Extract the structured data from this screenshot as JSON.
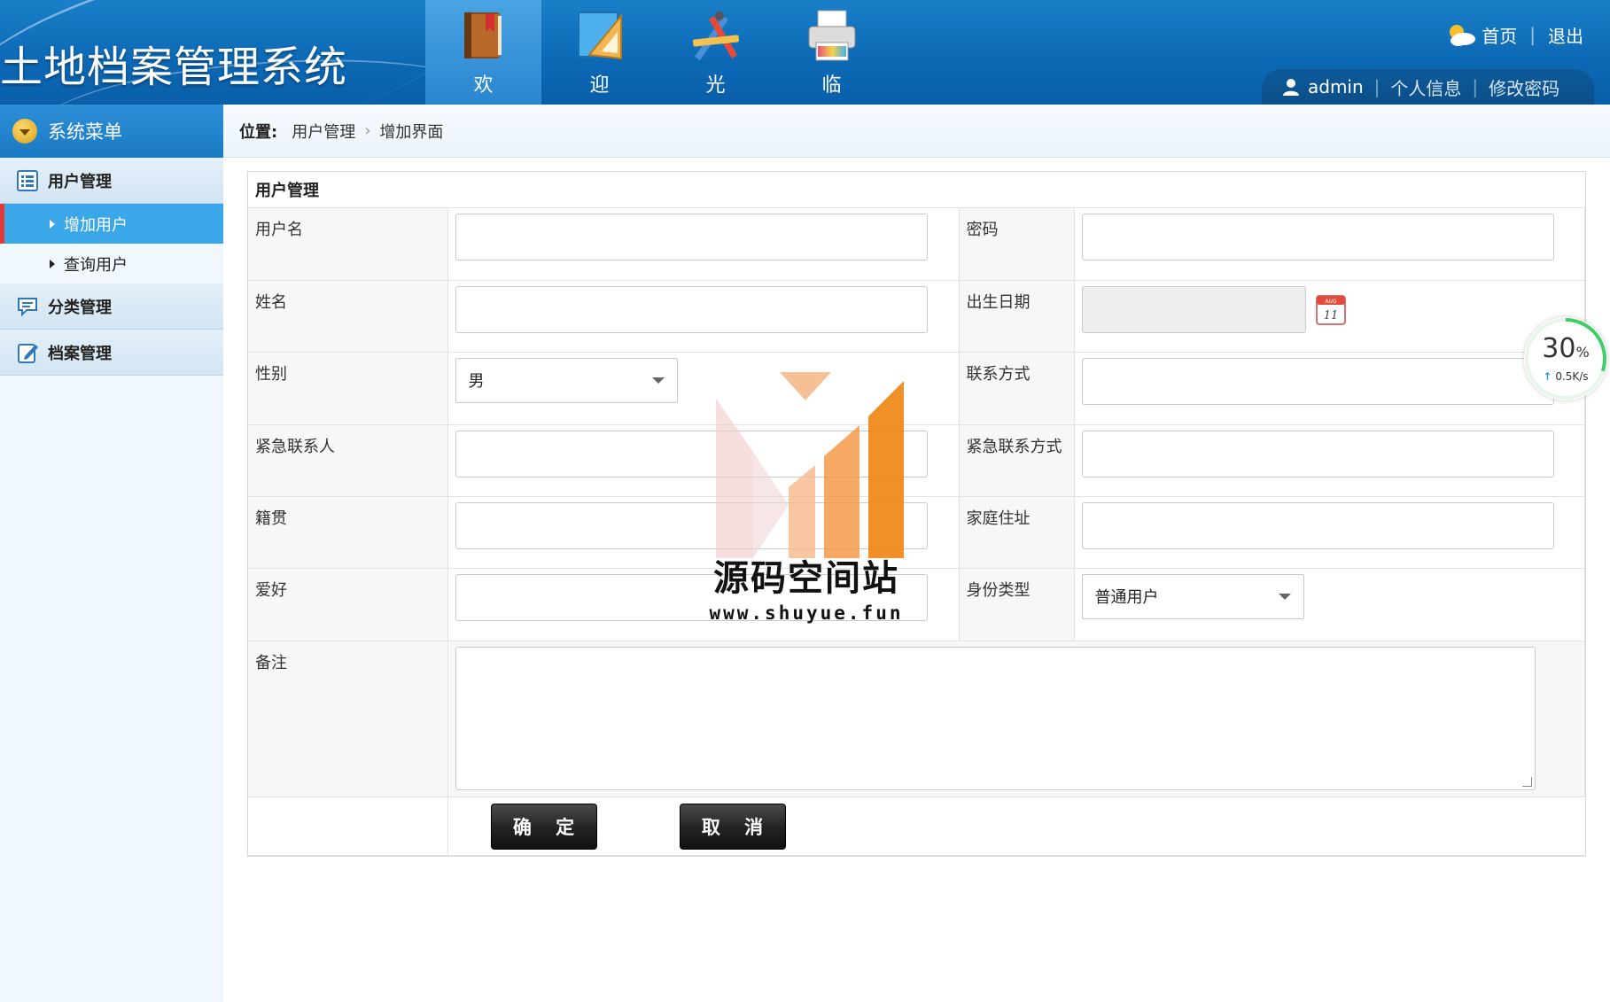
{
  "app": {
    "title": "土地档案管理系统"
  },
  "topnav": [
    {
      "label": "欢",
      "icon": "book-icon"
    },
    {
      "label": "迎",
      "icon": "ruler-triangle-icon"
    },
    {
      "label": "光",
      "icon": "drawing-tools-icon"
    },
    {
      "label": "临",
      "icon": "printer-icon"
    }
  ],
  "toplinks": {
    "home": "首页",
    "logout": "退出"
  },
  "userbar": {
    "username": "admin",
    "profile": "个人信息",
    "change_password": "修改密码"
  },
  "sidebar": {
    "header": "系统菜单",
    "groups": [
      {
        "label": "用户管理",
        "items": [
          {
            "label": "增加用户",
            "active": true
          },
          {
            "label": "查询用户",
            "active": false
          }
        ]
      },
      {
        "label": "分类管理"
      },
      {
        "label": "档案管理"
      }
    ]
  },
  "breadcrumb": {
    "prefix": "位置:",
    "items": [
      "用户管理",
      "增加界面"
    ]
  },
  "form": {
    "title": "用户管理",
    "fields": {
      "username": "用户名",
      "password": "密码",
      "name": "姓名",
      "birthdate": "出生日期",
      "gender": "性别",
      "gender_value": "男",
      "contact": "联系方式",
      "emergency_contact": "紧急联系人",
      "emergency_phone": "紧急联系方式",
      "native_place": "籍贯",
      "address": "家庭住址",
      "hobby": "爱好",
      "identity_type": "身份类型",
      "identity_value": "普通用户",
      "remark": "备注"
    },
    "calendar_icon_text": {
      "month": "AUG",
      "day": "11"
    },
    "confirm": "确 定",
    "cancel": "取 消"
  },
  "speed_widget": {
    "percent": "30",
    "percent_unit": "%",
    "rate": "0.5K/s"
  },
  "watermark": {
    "text": "源码空间站",
    "url": "www.shuyue.fun"
  }
}
